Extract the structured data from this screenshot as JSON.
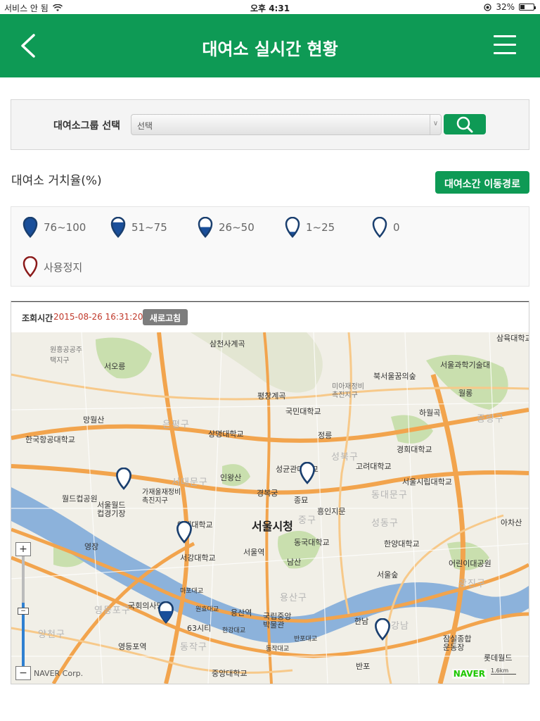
{
  "status_bar": {
    "carrier": "서비스 안 됨",
    "time": "오후 4:31",
    "battery": "32%",
    "battery_level": 0.32
  },
  "header": {
    "title": "대여소 실시간 현황",
    "back_icon": "chevron-left-icon",
    "menu_icon": "hamburger-menu-icon"
  },
  "filter": {
    "label": "대여소그룹 선택",
    "select_value": "선택",
    "search_icon": "search-icon"
  },
  "occupancy": {
    "title": "대여소 거치율(%)",
    "route_button": "대여소간 이동경로"
  },
  "legend": [
    {
      "label": "76~100",
      "fill_level": 1.0,
      "color": "#1a4f9a"
    },
    {
      "label": "51~75",
      "fill_level": 0.75,
      "color": "#1a4f9a"
    },
    {
      "label": "26~50",
      "fill_level": 0.5,
      "color": "#1a4f9a"
    },
    {
      "label": "1~25",
      "fill_level": 0.25,
      "color": "#1a4f9a"
    },
    {
      "label": "0",
      "fill_level": 0.0,
      "color": "#1a4f9a"
    },
    {
      "label": "사용정지",
      "fill_level": 0.0,
      "color": "#8b1a1a"
    }
  ],
  "map_panel": {
    "query_label": "조회시간",
    "query_time": "2015-08-26 16:31:20",
    "refresh_button": "새로고침",
    "credit": "NAVER Corp.",
    "brand": "NAVER",
    "scale": "1.6km",
    "zoom_level": 0.58,
    "places": {
      "p1": "삼천사계곡",
      "p2": "서오릉",
      "p3": "원흥공공주택지구",
      "p4": "평창계곡",
      "p5": "국민대학교",
      "p6": "북서울꿈의숲",
      "p7": "서울과학기술대",
      "p8": "망월산",
      "p9": "한국항공대학교",
      "p10": "은평구",
      "p11": "상명대학교",
      "p12": "정릉",
      "p13": "성북구",
      "p14": "고려대학교",
      "p15": "경희대학교",
      "p16": "서울시립대학교",
      "p17": "중랑구",
      "p18": "인왕산",
      "p19": "서대문구",
      "p20": "경복궁",
      "p21": "종묘",
      "p22": "흥인지문",
      "p23": "동대문구",
      "p24": "서울시청",
      "p25": "중구",
      "p26": "성동구",
      "p27": "서강대학교",
      "p28": "서울역",
      "p29": "남산",
      "p30": "한양대학교",
      "p31": "어린이대공원",
      "p32": "광진구",
      "p33": "국회의사당",
      "p34": "영등포구",
      "p35": "용산역",
      "p36": "국립중앙박물관",
      "p37": "한남",
      "p38": "용산구",
      "p39": "63시티",
      "p40": "동작구",
      "p41": "영등포역",
      "p42": "잠실종합운동장",
      "p43": "롯데월드",
      "p44": "아차산",
      "p45": "양천구",
      "p46": "중앙대학교",
      "p47": "반포",
      "p48": "강남",
      "p49": "성균관대학교",
      "p50": "월드컵공원",
      "p51": "서울월드컵경기장",
      "p52": "가재울재정비촉진지구",
      "p53": "연세대학교",
      "p54": "동국대학교",
      "p55": "하월곡",
      "p56": "월롱",
      "p57": "미아재정비촉진지구",
      "p58": "삼육대학교",
      "p59": "영장",
      "p60": "서울숲",
      "p61": "마포대교",
      "p62": "원효대교",
      "p63": "한강대교",
      "p64": "동작대교",
      "p65": "반포대교"
    }
  }
}
